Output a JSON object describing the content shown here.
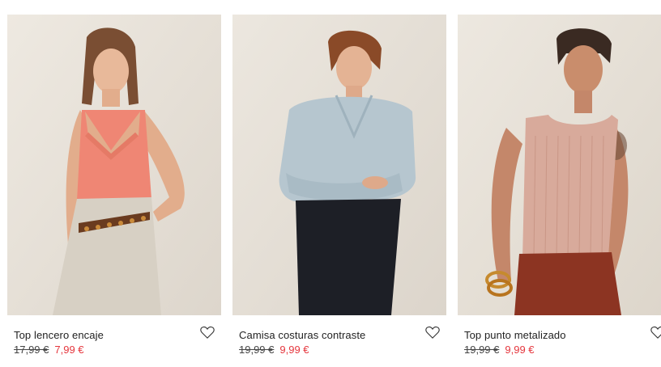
{
  "products": [
    {
      "name": "Top lencero encaje",
      "old_price": "17,99 €",
      "new_price": "7,99 €",
      "photo_alt": "Model wearing a coral satin camisole with lace trim and beige trousers with a tortoiseshell belt"
    },
    {
      "name": "Camisa costuras contraste",
      "old_price": "19,99 €",
      "new_price": "9,99 €",
      "photo_alt": "Model wearing a light blue shirt and black high-waisted trousers"
    },
    {
      "name": "Top punto metalizado",
      "old_price": "19,99 €",
      "new_price": "9,99 €",
      "photo_alt": "Model wearing a pink ribbed knit tank top and rust trousers"
    }
  ],
  "icons": {
    "favorite": "heart-outline-icon"
  },
  "colors": {
    "sale_price": "#e5363d",
    "photo_background": "#e9e4dc"
  }
}
